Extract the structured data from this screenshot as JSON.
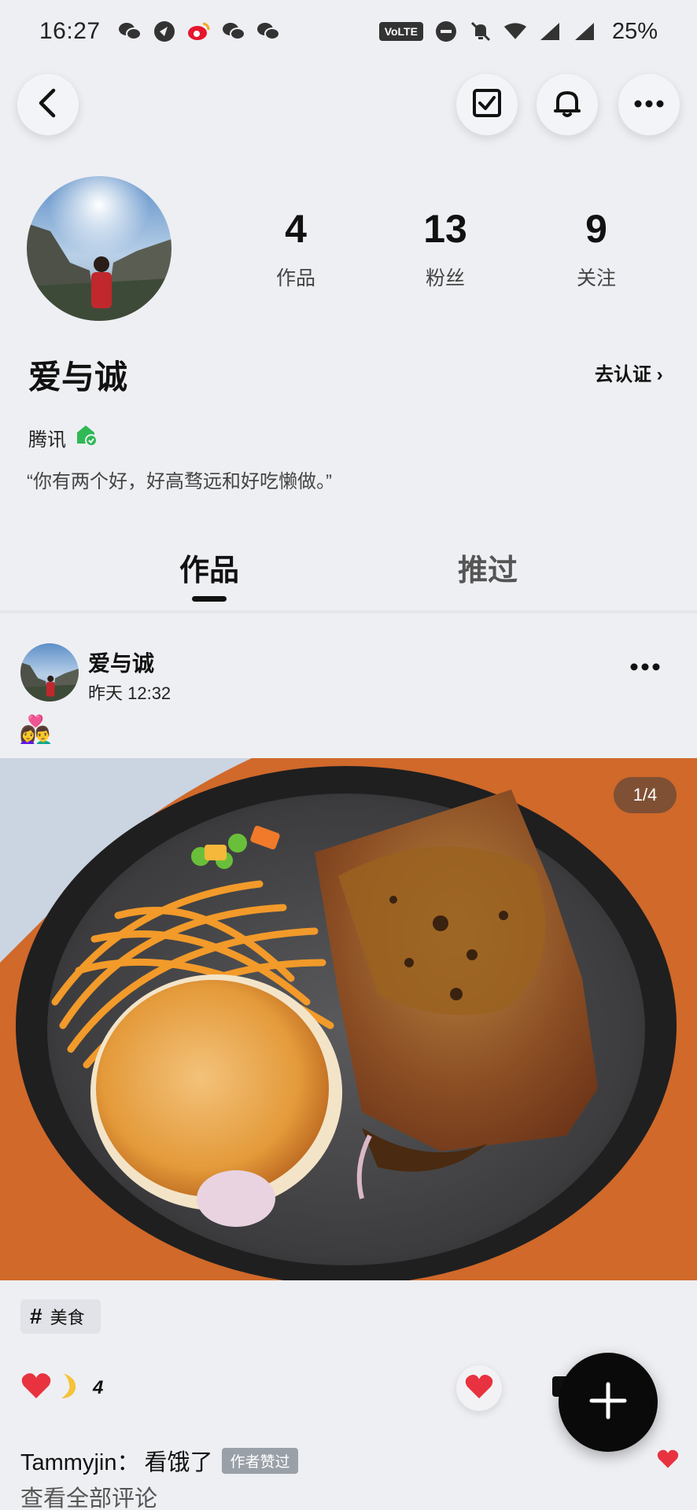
{
  "status_bar": {
    "time": "16:27",
    "network_label": "VoLTE",
    "battery": "25%"
  },
  "header": {
    "back_icon": "chevron-left-icon",
    "check_icon": "checkbox-icon",
    "bell_icon": "bell-icon",
    "more_icon": "more-dots-icon"
  },
  "profile": {
    "stats": [
      {
        "value": "4",
        "label": "作品"
      },
      {
        "value": "13",
        "label": "粉丝"
      },
      {
        "value": "9",
        "label": "关注"
      }
    ],
    "name": "爱与诚",
    "verify_link": "去认证 ›",
    "org": "腾讯",
    "bio": "“你有两个好，好高骛远和好吃懒做。”"
  },
  "tabs": [
    {
      "label": "作品",
      "active": true
    },
    {
      "label": "推过",
      "active": false
    }
  ],
  "post": {
    "author": "爱与诚",
    "time": "昨天 12:32",
    "emoji": "👩‍❤️‍👨",
    "page_indicator": "1/4",
    "tag": "美食",
    "reaction_count": "4",
    "comment": {
      "author": "Tammyjin：",
      "text": "看饿了",
      "badge": "作者赞过"
    },
    "view_all_comments": "查看全部评论"
  },
  "colors": {
    "background": "#eeeff3",
    "heart": "#e8323f",
    "fab": "#0a0a0a"
  }
}
